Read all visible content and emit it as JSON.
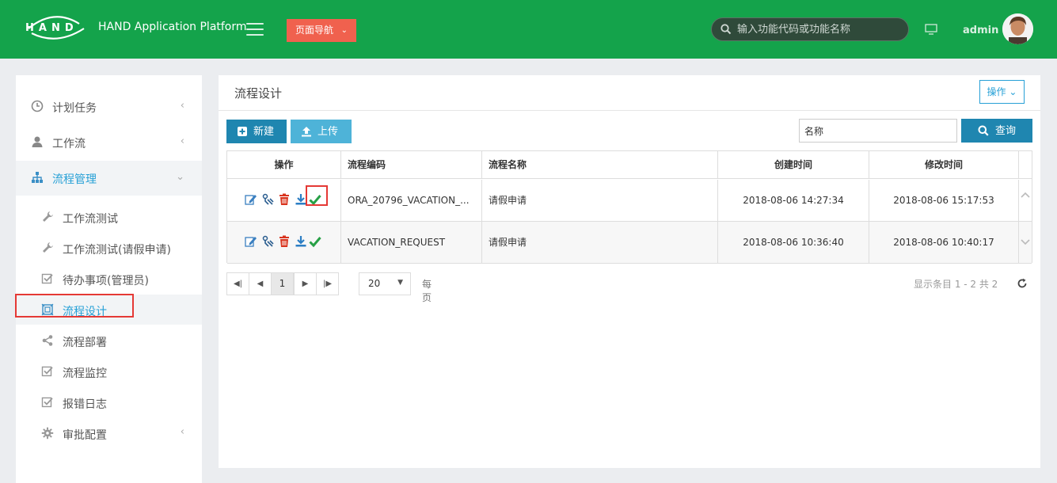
{
  "header": {
    "app_title": "HAND Application Platform",
    "page_nav_label": "页面导航",
    "search_placeholder": "输入功能代码或功能名称",
    "username": "admin",
    "brand_color": "#14a34b"
  },
  "sidebar": {
    "items": [
      {
        "label": "计划任务",
        "icon": "clock-icon",
        "expanded": false
      },
      {
        "label": "工作流",
        "icon": "user-icon",
        "expanded": false
      },
      {
        "label": "流程管理",
        "icon": "sitemap-icon",
        "expanded": true
      }
    ],
    "sub_items": [
      {
        "label": "工作流测试",
        "icon": "wrench-icon"
      },
      {
        "label": "工作流测试(请假申请)",
        "icon": "wrench-icon"
      },
      {
        "label": "待办事项(管理员)",
        "icon": "checkbox-icon"
      },
      {
        "label": "流程设计",
        "icon": "design-icon",
        "current": true
      },
      {
        "label": "流程部署",
        "icon": "share-icon"
      },
      {
        "label": "流程监控",
        "icon": "checkbox-icon"
      },
      {
        "label": "报错日志",
        "icon": "checkbox-icon"
      },
      {
        "label": "审批配置",
        "icon": "gear-icon"
      }
    ]
  },
  "main": {
    "title": "流程设计",
    "ops_label": "操作",
    "new_label": "新建",
    "upload_label": "上传",
    "name_input_value": "名称",
    "query_label": "查询",
    "columns": [
      "操作",
      "流程编码",
      "流程名称",
      "创建时间",
      "修改时间"
    ],
    "rows": [
      {
        "code": "ORA_20796_VACATION_...",
        "name": "请假申请",
        "created": "2018-08-06 14:27:34",
        "modified": "2018-08-06 15:17:53"
      },
      {
        "code": "VACATION_REQUEST",
        "name": "请假申请",
        "created": "2018-08-06 10:36:40",
        "modified": "2018-08-06 10:40:17"
      }
    ],
    "pager": {
      "current_page": "1",
      "page_size": "20",
      "per_page_label": "每页",
      "info": "显示条目 1 - 2 共 2"
    }
  },
  "colors": {
    "accent_blue": "#1f86b0",
    "upload_blue": "#4eb3d8",
    "page_nav_red": "#f0614e",
    "highlight_red": "#e53935"
  }
}
